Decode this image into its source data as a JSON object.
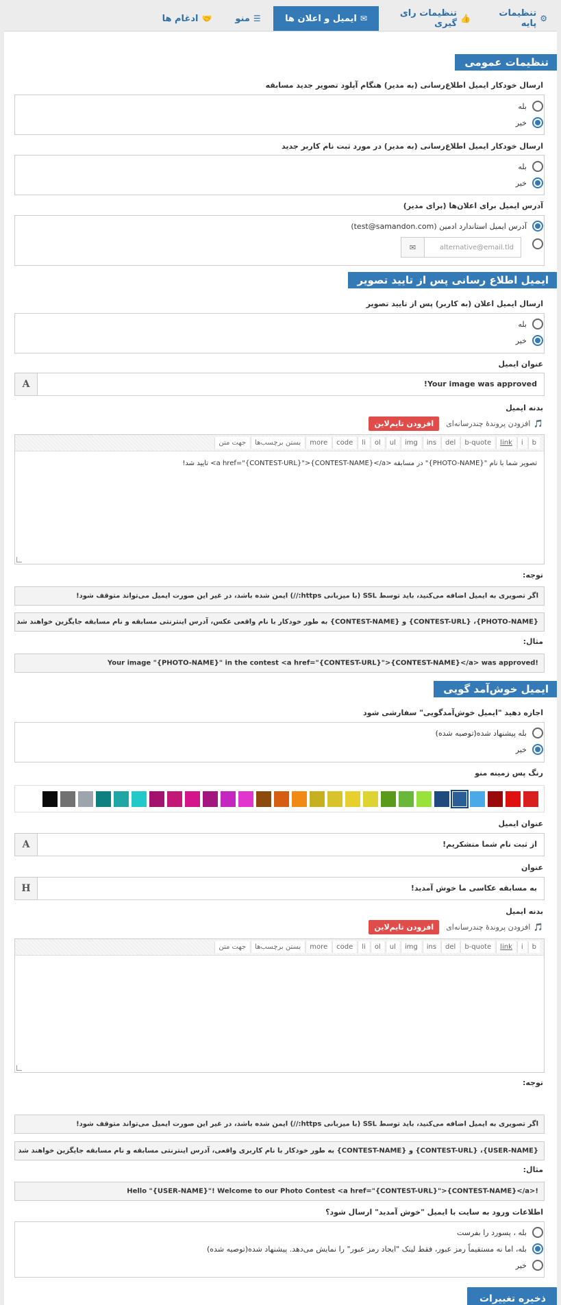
{
  "tabs": [
    {
      "label": "تنظیمات پایه",
      "icon": "gears-icon"
    },
    {
      "label": "تنظیمات رای گیری",
      "icon": "thumbs-up-icon"
    },
    {
      "label": "ایمیل و اعلان ها",
      "icon": "envelope-icon",
      "active": true
    },
    {
      "label": "منو",
      "icon": "bars-icon"
    },
    {
      "label": "ادغام ها",
      "icon": "handshake-icon"
    }
  ],
  "general": {
    "title": "تنظیمات عمومی",
    "q1": {
      "label": "ارسال خودکار ایمیل اطلاع‌رسانی (به مدیر) هنگام آپلود تصویر جدید مسابقه",
      "yes": "بله",
      "no": "خیر",
      "selected": "no"
    },
    "q2": {
      "label": "ارسال خودکار ایمیل اطلاع‌رسانی (به مدیر) در مورد ثبت نام کاربر جدید",
      "yes": "بله",
      "no": "خیر",
      "selected": "no"
    },
    "email": {
      "label": "آدرس ایمیل برای اعلان‌ها (برای مدیر)",
      "standard": "آدرس ایمیل استاندارد ادمین (test@samandon.com)",
      "alt_placeholder": "alternative@email.tld",
      "selected": "standard"
    }
  },
  "approval": {
    "title": "ایمیل اطلاع رسانی پس از تایید تصویر",
    "send": {
      "label": "ارسال ایمیل اعلان (به کاربر) پس از تایید تصویر",
      "yes": "بله",
      "no": "خیر",
      "selected": "no"
    },
    "subject_label": "عنوان ایمیل",
    "subject_value": "Your image was approved!",
    "body_label": "بدنه ایمیل",
    "add_media": "افزودن پروندهٔ چندرسانه‌ای",
    "add_timeline": "افزودن تایم‌لاین",
    "body_text": "تصویر شما با نام \"{PHOTO-NAME}\" در مسابقه <a href=\"{CONTEST-URL}\">{CONTEST-NAME}</a> تایید شد!",
    "note_label": "توجه:",
    "note1": "اگر تصویری به ایمیل اضافه می‌کنید، باید توسط SSL (با میزبانی https://) ایمن شده باشد، در غیر این صورت ایمیل می‌تواند متوقف شود!",
    "note2": "{PHOTO-NAME}، {CONTEST-URL} و {CONTEST-NAME} به طور خودکار با نام واقعی عکس، آدرس اینترنتی مسابقه و نام مسابقه جایگزین خواهند شد",
    "example_label": "مثال:",
    "example": "Your image \"{PHOTO-NAME}\" in the contest <a href=\"{CONTEST-URL}\">{CONTEST-NAME}</a> was approved!"
  },
  "toolbar": [
    "b",
    "i",
    "link",
    "b-quote",
    "del",
    "ins",
    "img",
    "ul",
    "ol",
    "li",
    "code",
    "more",
    "بستن برچسب‌ها",
    "جهت متن"
  ],
  "welcome": {
    "title": "ایمیل خوش‌آمد گویی",
    "allow": {
      "label": "اجازه دهید \"ایمیل خوش‌آمدگویی\" سفارشی شود",
      "yes": "بله پیشنهاد شده(توصیه شده)",
      "no": "خیر",
      "selected": "no"
    },
    "color_label": "رنگ پس زمینه منو",
    "colors": [
      "#d91f1f",
      "#e0120f",
      "#9b0a0a",
      "#4aa9e6",
      "#2b5e97",
      "#1f4a7e",
      "#99e23c",
      "#6ab83a",
      "#5a9a1a",
      "#ddd433",
      "#e6cf2e",
      "#d9c32a",
      "#c7b020",
      "#f18a15",
      "#d55e12",
      "#8c4b0d",
      "#e234cf",
      "#c427bd",
      "#a3157f",
      "#d4148a",
      "#c21876",
      "#a4126f",
      "#23c9c8",
      "#1fa6a5",
      "#0f8080",
      "#9da4ad",
      "#717171",
      "#0a0a0a"
    ],
    "selected_color": "#2b5e97",
    "subject_label": "عنوان ایمیل",
    "subject_value": "از ثبت نام شما متشکریم!",
    "heading_label": "عنوان",
    "heading_value": "به مسابقه عکاسی ما خوش آمدید!",
    "body_label": "بدنه ایمیل",
    "add_media": "افزودن پروندهٔ چندرسانه‌ای",
    "add_timeline": "افزودن تایم‌لاین",
    "note_label": "توجه:",
    "note1": "اگر تصویری به ایمیل اضافه می‌کنید، باید توسط SSL (با میزبانی https://) ایمن شده باشد، در غیر این صورت ایمیل می‌تواند متوقف شود!",
    "note2": "{USER-NAME}، {CONTEST-URL} و {CONTEST-NAME} به طور خودکار با نام کاربری واقعی، آدرس اینترنتی مسابقه و نام مسابقه جایگزین خواهند شد",
    "example_label": "مثال:",
    "example": "Hello \"{USER-NAME}\"! Welcome to our Photo Contest <a href=\"{CONTEST-URL}\">{CONTEST-NAME}</a>!",
    "login": {
      "label": "اطلاعات ورود به سایت با ایمیل \"خوش آمدید\" ارسال شود؟",
      "opt1": "بله ، پسورد را بفرست",
      "opt2": "بله، اما نه مستقیماً رمز عبور، فقط لینک \"ایجاد رمز عبور\" را نمایش می‌دهد. پیشنهاد شده(توصیه شده)",
      "opt3": "خیر",
      "selected": "opt2"
    }
  },
  "save_label": "ذخیره تغییرات"
}
